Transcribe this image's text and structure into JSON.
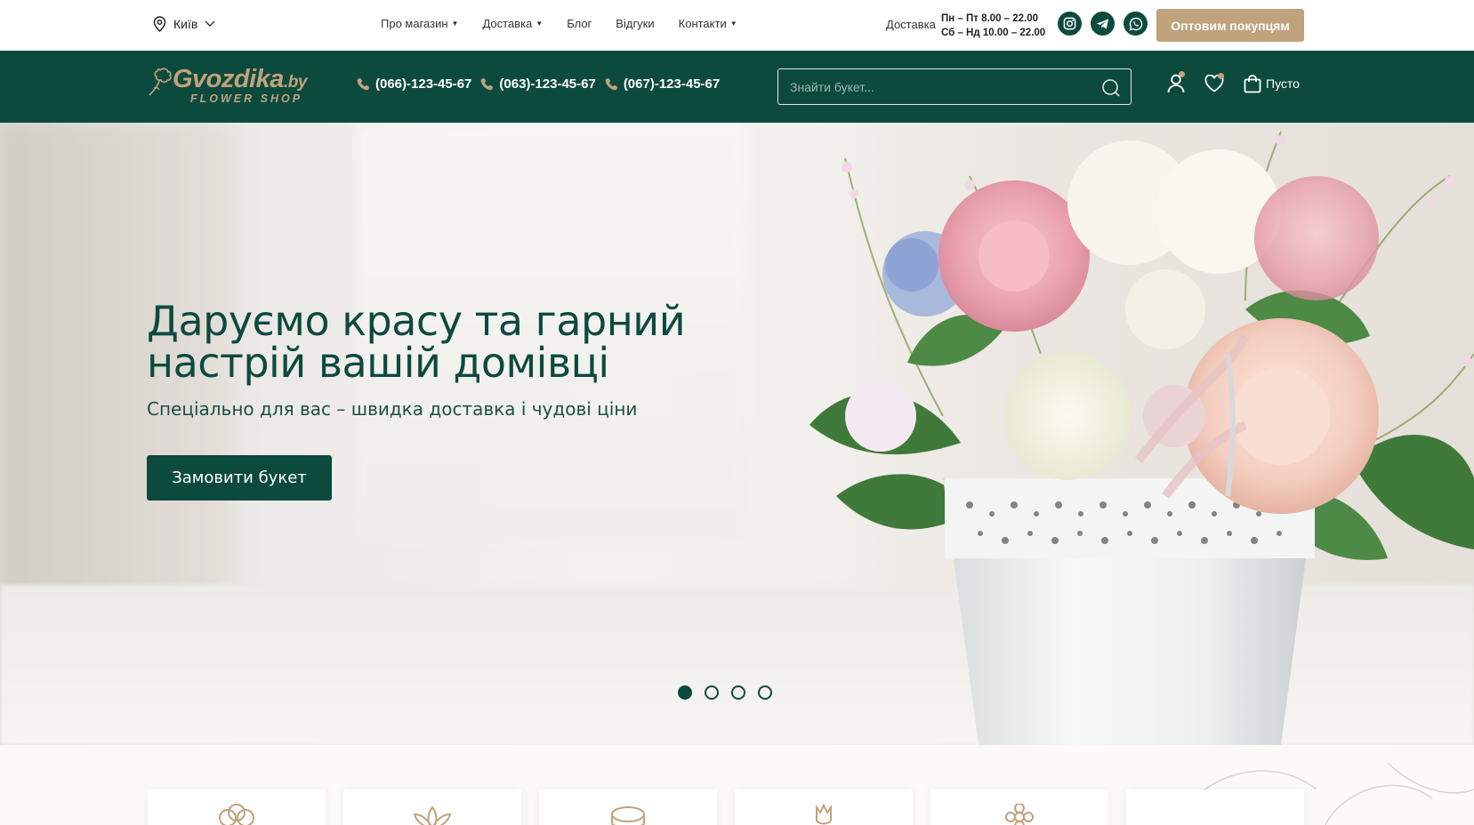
{
  "topbar": {
    "city": "Київ",
    "nav": [
      {
        "label": "Про магазин",
        "dropdown": true
      },
      {
        "label": "Доставка",
        "dropdown": true
      },
      {
        "label": "Блог",
        "dropdown": false
      },
      {
        "label": "Відгуки",
        "dropdown": false
      },
      {
        "label": "Контакти",
        "dropdown": true
      }
    ],
    "delivery_label": "Доставка",
    "hours_weekdays": "Пн – Пт 8.00 – 22.00",
    "hours_weekend": "Сб – Нд 10.00 – 22.00",
    "social": [
      "instagram-icon",
      "telegram-icon",
      "whatsapp-icon"
    ],
    "wholesale_button": "Оптовим покупцям"
  },
  "header": {
    "logo_brand": "Gvozdika",
    "logo_domain": ".by",
    "logo_tagline": "FLOWER SHOP",
    "phones": [
      "(066)-123-45-67",
      "(063)-123-45-67",
      "(067)-123-45-67"
    ],
    "search_placeholder": "Знайти букет...",
    "cart_label": "Пусто"
  },
  "hero": {
    "title_line1": "Даруємо красу та гарний",
    "title_line2": "настрій вашій домівці",
    "subtitle": "Спеціально для вас – швидка доставка і чудові ціни",
    "button": "Замовити букет",
    "slides_total": 4,
    "active_slide": 1
  },
  "colors": {
    "primary": "#0d4a3e",
    "accent": "#c0a27d"
  }
}
